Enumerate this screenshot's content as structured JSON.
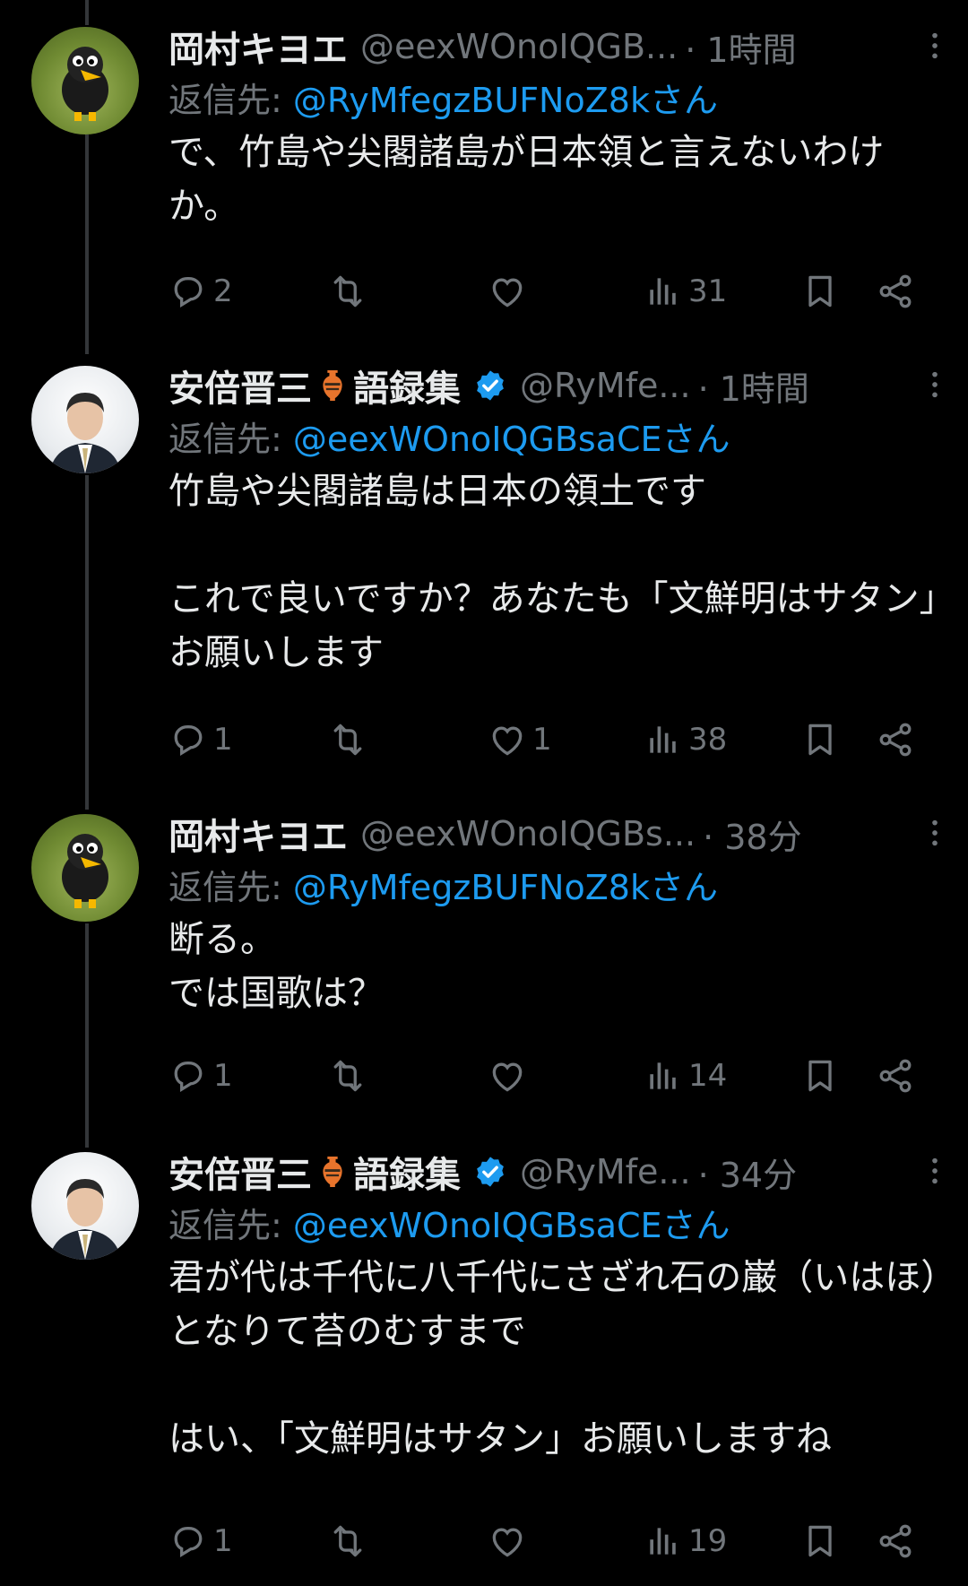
{
  "tweets": [
    {
      "author": "岡村キヨエ",
      "handle": "@eexWOnoIQGB...",
      "time": "· 1時間",
      "reply_label": "返信先: ",
      "reply_mention": "@RyMfegzBUFNoZ8kさん",
      "text": "で、竹島や尖閣諸島が日本領と言えないわけか。",
      "replies": "2",
      "retweets": "",
      "likes": "",
      "views": "31",
      "avatar": "crow-figurine",
      "verified": false
    },
    {
      "author": "安倍晋三",
      "author_suffix": "語録集",
      "handle": "@RyMfe...",
      "time": "· 1時間",
      "reply_label": "返信先: ",
      "reply_mention": "@eexWOnoIQGBsaCEさん",
      "text": "竹島や尖閣諸島は日本の領土です\n\nこれで良いですか？あなたも「文鮮明はサタン」お願いします",
      "replies": "1",
      "retweets": "",
      "likes": "1",
      "views": "38",
      "avatar": "portrait",
      "verified": true
    },
    {
      "author": "岡村キヨエ",
      "handle": "@eexWOnoIQGBs...",
      "time": "· 38分",
      "reply_label": "返信先: ",
      "reply_mention": "@RyMfegzBUFNoZ8kさん",
      "text": "断る。\nでは国歌は？",
      "replies": "1",
      "retweets": "",
      "likes": "",
      "views": "14",
      "avatar": "crow-figurine",
      "verified": false
    },
    {
      "author": "安倍晋三",
      "author_suffix": "語録集",
      "handle": "@RyMfe...",
      "time": "· 34分",
      "reply_label": "返信先: ",
      "reply_mention": "@eexWOnoIQGBsaCEさん",
      "text": "君が代は千代に八千代にさざれ石の巌（いはほ）となりて苔のむすまで\n\nはい、「文鮮明はサタン」お願いしますね",
      "replies": "1",
      "retweets": "",
      "likes": "",
      "views": "19",
      "avatar": "portrait",
      "verified": true
    }
  ],
  "colors": {
    "background": "#000000",
    "text": "#e7e9ea",
    "secondary": "#71767b",
    "link": "#1d9bf0"
  }
}
